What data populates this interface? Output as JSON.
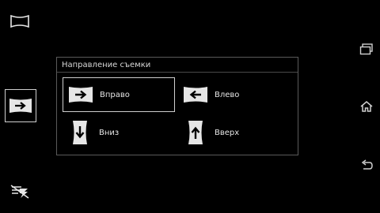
{
  "dialog": {
    "title": "Направление съемки",
    "options": [
      {
        "label": "Вправо",
        "icon": "pan-right-icon",
        "selected": true
      },
      {
        "label": "Влево",
        "icon": "pan-left-icon",
        "selected": false
      },
      {
        "label": "Вниз",
        "icon": "pan-down-icon",
        "selected": false
      },
      {
        "label": "Вверх",
        "icon": "pan-up-icon",
        "selected": false
      }
    ]
  },
  "left_strip": {
    "icons": [
      "panorama-mode-icon",
      "direction-right-icon",
      "flash-off-icon"
    ]
  },
  "navbar": {
    "icons": [
      "recent-apps-icon",
      "home-icon",
      "back-icon"
    ]
  },
  "colors": {
    "background": "#000000",
    "icon": "#e6e6e6",
    "dialog_border": "#5a5a5a",
    "selected_border": "#cfcfcf",
    "text": "#e6e6e6"
  }
}
